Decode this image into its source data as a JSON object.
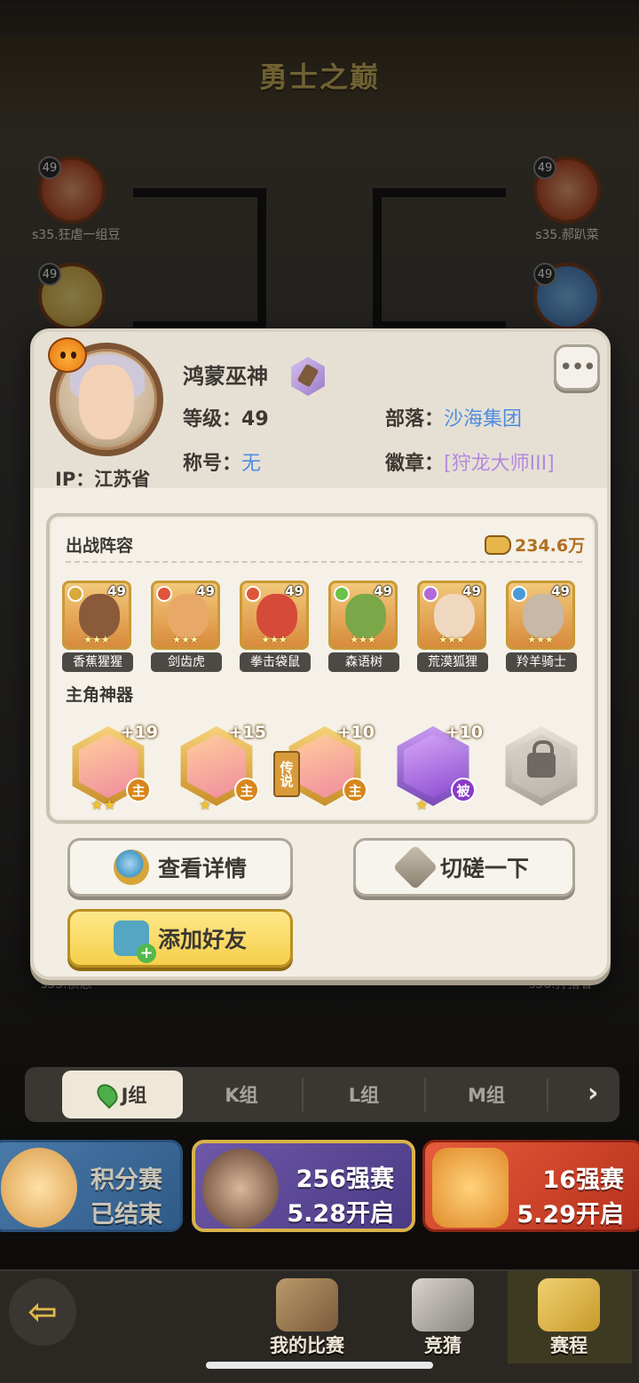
{
  "header": {
    "title": "勇士之巅"
  },
  "bracket": {
    "players": [
      {
        "name": "s35.狂虐一组豆",
        "level": "49"
      },
      {
        "name": "s35.郝趴菜",
        "level": "49"
      },
      {
        "name": "",
        "level": "49"
      },
      {
        "name": "",
        "level": "49"
      }
    ],
    "bottom_left_partial": "s35.愤怒",
    "bottom_right_partial": "s36.狩猎者"
  },
  "profile": {
    "name": "鸿蒙巫神",
    "ip_label": "IP：",
    "ip_value": "江苏省",
    "level_label": "等级：",
    "level_value": "49",
    "tribe_label": "部落：",
    "tribe_value": "沙海集团",
    "title_label": "称号：",
    "title_value": "无",
    "badge_label": "徽章：",
    "badge_value": "[狩龙大师III]",
    "more_button": "•••"
  },
  "lineup": {
    "title": "出战阵容",
    "power": "234.6万",
    "heroes": [
      {
        "name": "香蕉猩猩",
        "level": "49",
        "stars": "★★★",
        "color": "#8a5a3a",
        "badge_color": "#d9a93a"
      },
      {
        "name": "剑齿虎",
        "level": "49",
        "stars": "★★★",
        "color": "#e8a868",
        "badge_color": "#e0553a"
      },
      {
        "name": "拳击袋鼠",
        "level": "49",
        "stars": "★★★",
        "color": "#d64a3a",
        "badge_color": "#e0553a"
      },
      {
        "name": "森语树",
        "level": "49",
        "stars": "★★★",
        "color": "#7aa848",
        "badge_color": "#6ac24a"
      },
      {
        "name": "荒漠狐狸",
        "level": "49",
        "stars": "★★★",
        "color": "#f0d8c0",
        "badge_color": "#b06ad8"
      },
      {
        "name": "羚羊骑士",
        "level": "49",
        "stars": "★★★",
        "color": "#c8b8a8",
        "badge_color": "#4a9ad8"
      }
    ]
  },
  "artifacts": {
    "title": "主角神器",
    "legend_tag": "传说",
    "items": [
      {
        "plus": "+19",
        "tag": "主",
        "stars": "★★",
        "kind": "gold"
      },
      {
        "plus": "+15",
        "tag": "主",
        "stars": "★",
        "kind": "gold"
      },
      {
        "plus": "+10",
        "tag": "主",
        "stars": "",
        "kind": "gold"
      },
      {
        "plus": "+10",
        "tag": "被",
        "stars": "★",
        "kind": "purple"
      },
      {
        "plus": "",
        "tag": "",
        "stars": "",
        "kind": "locked"
      }
    ]
  },
  "actions": {
    "view_details": "查看详情",
    "spar": "切磋一下",
    "add_friend": "添加好友"
  },
  "groups": {
    "tabs": [
      "J组",
      "K组",
      "L组",
      "M组"
    ],
    "active": "J组"
  },
  "stages": [
    {
      "line1": "积分赛",
      "line2": "已结束"
    },
    {
      "line1": "256强赛",
      "line2": "5.28开启"
    },
    {
      "line1": "16强赛",
      "line2": "5.29开启"
    }
  ],
  "nav": {
    "my_matches": "我的比赛",
    "guess": "竞猜",
    "schedule": "赛程"
  }
}
